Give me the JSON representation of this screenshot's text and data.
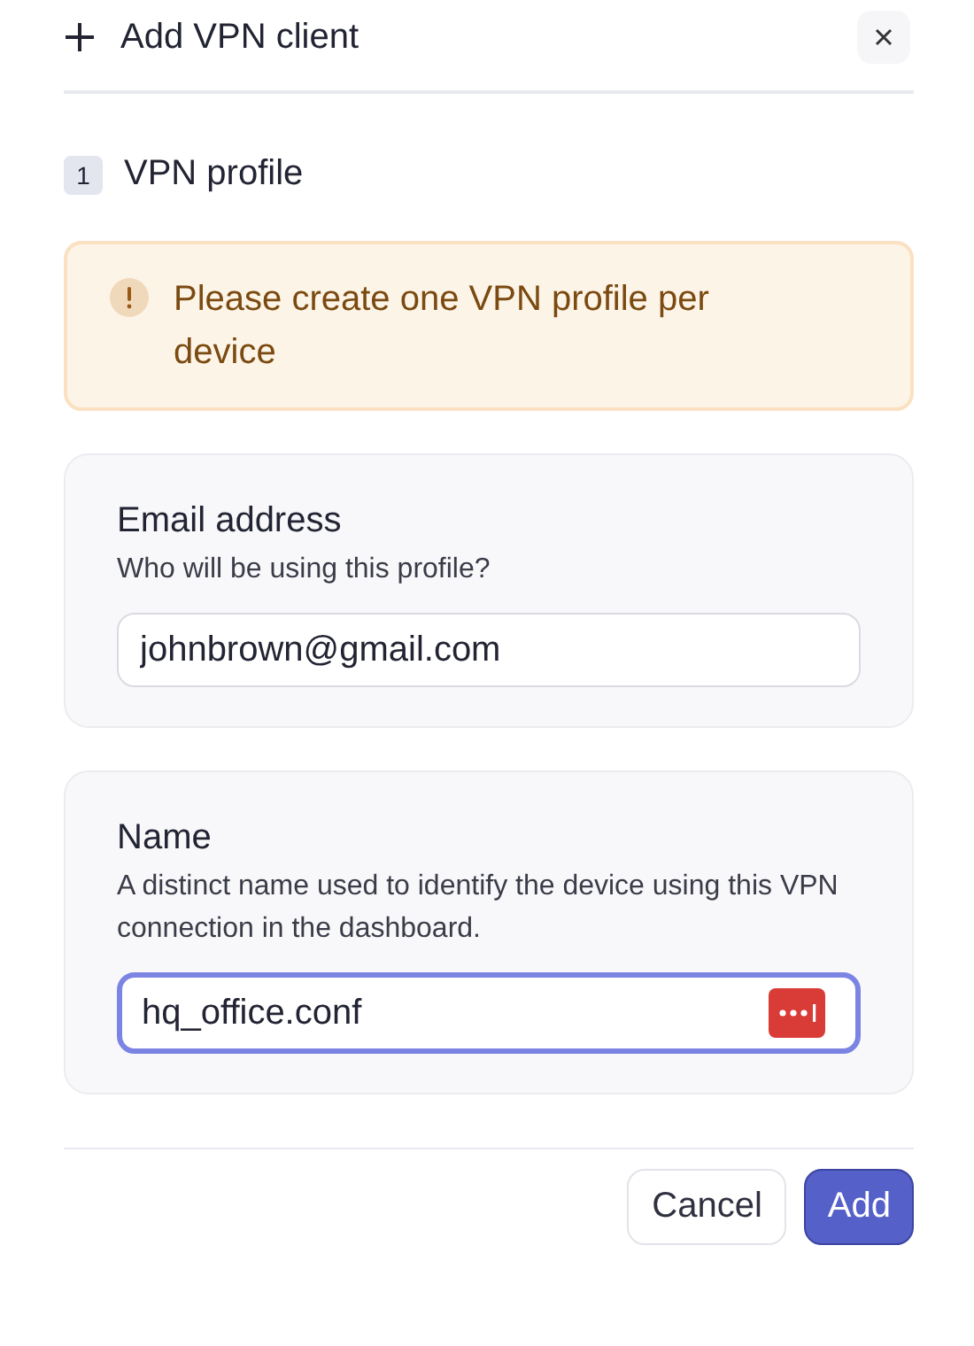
{
  "dialog": {
    "title": "Add VPN client"
  },
  "step": {
    "number": "1",
    "title": "VPN profile"
  },
  "alert": {
    "text": "Please create one VPN profile per device"
  },
  "fields": [
    {
      "label": "Email address",
      "hint": "Who will be using this profile?",
      "value": "johnbrown@gmail.com",
      "focused": false,
      "password_manager": false
    },
    {
      "label": "Name",
      "hint": "A distinct name used to identify the device using this VPN connection in the dashboard.",
      "value": "hq_office.conf",
      "focused": true,
      "password_manager": true
    }
  ],
  "buttons": [
    {
      "label": "Cancel",
      "primary": false
    },
    {
      "label": "Add",
      "primary": true
    }
  ]
}
